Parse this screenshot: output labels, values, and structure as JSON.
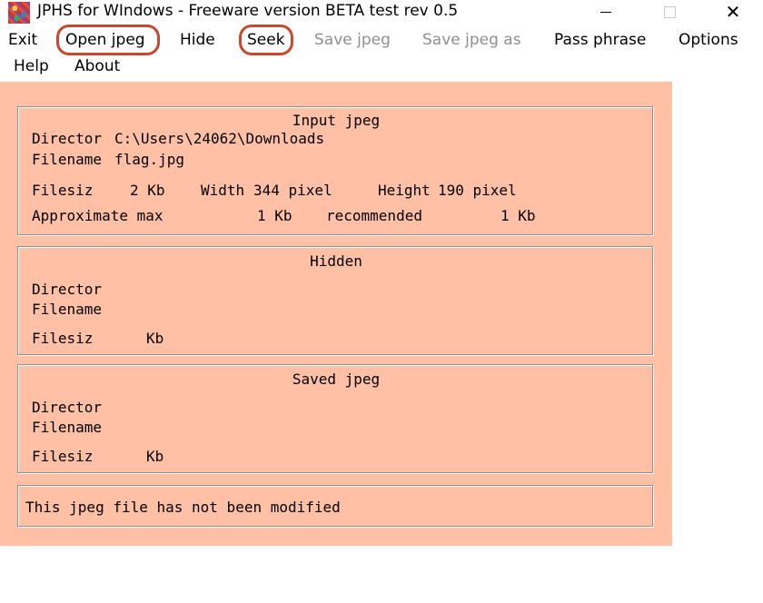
{
  "window": {
    "title": "JPHS for WIndows - Freeware version BETA test rev 0.5",
    "close_glyph": "✕"
  },
  "menu": {
    "exit": "Exit",
    "open_jpeg": "Open jpeg",
    "hide": "Hide",
    "seek": "Seek",
    "save_jpeg": "Save jpeg",
    "save_jpeg_as": "Save jpeg as",
    "pass_phrase": "Pass phrase",
    "options": "Options",
    "help": "Help",
    "about": "About"
  },
  "annotation_color": "#c8482f",
  "client_color": "#ffc0a6",
  "input_jpeg": {
    "title": "Input jpeg",
    "directory_label": "Director",
    "directory_value": "C:\\Users\\24062\\Downloads",
    "filename_label": "Filename",
    "filename_value": "flag.jpg",
    "filesize_label": "Filesiz",
    "filesize_value": "2 Kb",
    "width_label": "Width",
    "width_value": "344 pixel",
    "height_label": "Height",
    "height_value": "190 pixel",
    "approx_label": "Approximate max",
    "approx_value": "1 Kb",
    "recommended_label": "recommended",
    "recommended_value": "1 Kb"
  },
  "hidden": {
    "title": "Hidden",
    "directory_label": "Director",
    "filename_label": "Filename",
    "filesize_label": "Filesiz",
    "filesize_unit": "Kb"
  },
  "saved_jpeg": {
    "title": "Saved jpeg",
    "directory_label": "Director",
    "filename_label": "Filename",
    "filesize_label": "Filesiz",
    "filesize_unit": "Kb"
  },
  "status": {
    "message": "This jpeg file has not been modified"
  }
}
